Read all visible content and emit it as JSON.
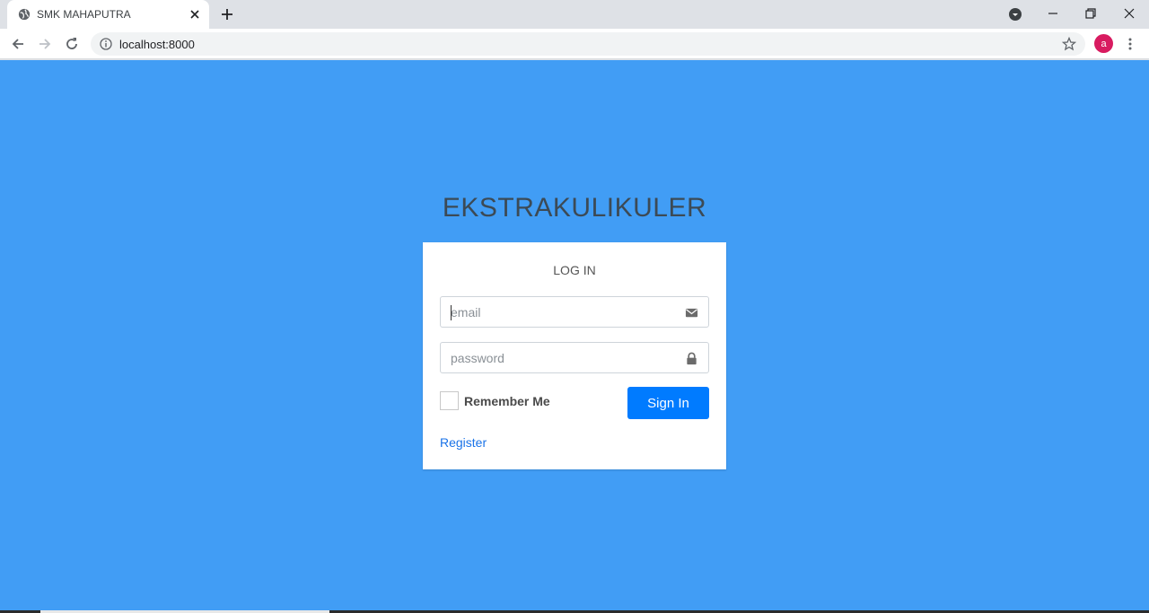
{
  "browser": {
    "tab_title": "SMK MAHAPUTRA",
    "url": "localhost:8000",
    "profile_initial": "a"
  },
  "page": {
    "brand": "EKSTRAKULIKULER",
    "background": "#419df5",
    "login": {
      "title": "LOG IN",
      "email_placeholder": "email",
      "password_placeholder": "password",
      "remember_label": "Remember Me",
      "remember_checked": false,
      "signin_label": "Sign In",
      "register_label": "Register"
    }
  },
  "icons": {
    "tab_favicon": "globe-icon",
    "email_field": "envelope-icon",
    "password_field": "lock-icon"
  },
  "colors": {
    "primary_button": "#007bff",
    "link": "#1a73e8",
    "avatar": "#d81b60"
  }
}
